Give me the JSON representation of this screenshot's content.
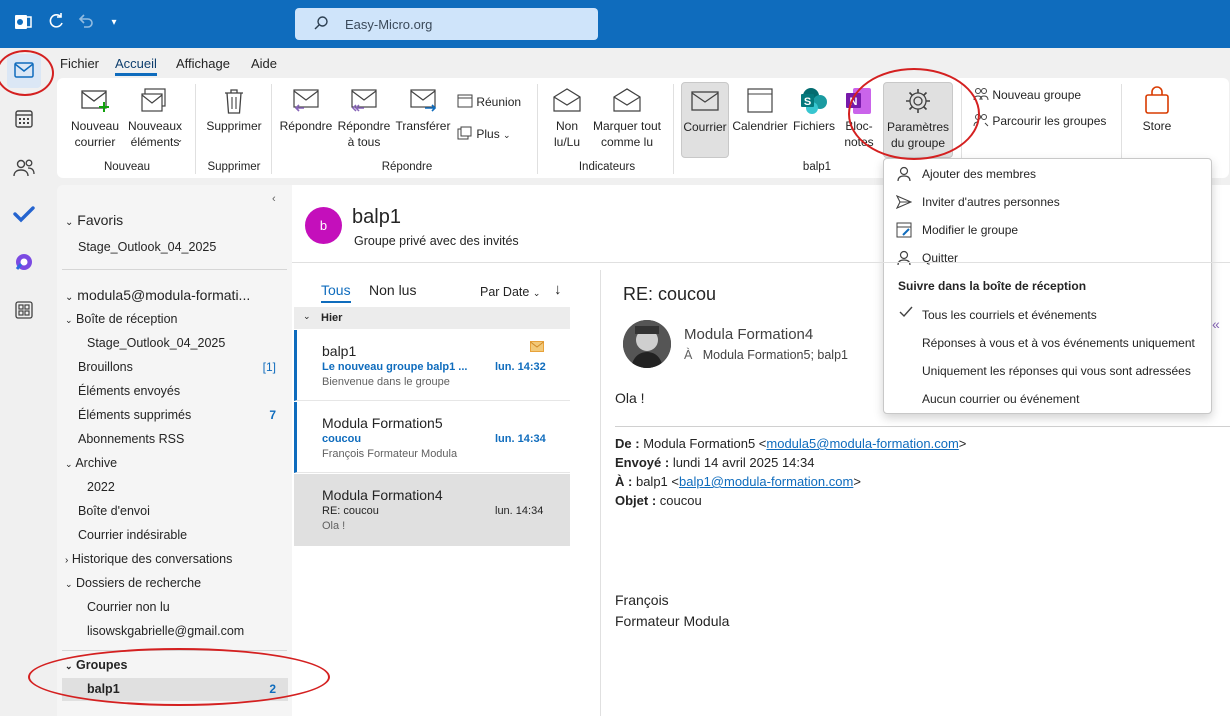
{
  "titlebar": {
    "search_text": "Easy-Micro.org"
  },
  "menu": {
    "tabs": [
      "Fichier",
      "Accueil",
      "Affichage",
      "Aide"
    ]
  },
  "ribbon": {
    "nouveau_courrier": "Nouveau\ncourrier",
    "nouveaux_elements": "Nouveaux\néléments",
    "group_nouveau": "Nouveau",
    "supprimer": "Supprimer",
    "group_supprimer": "Supprimer",
    "repondre": "Répondre",
    "repondre_tous": "Répondre\nà tous",
    "transferer": "Transférer",
    "reunion": "Réunion",
    "plus": "Plus",
    "group_repondre": "Répondre",
    "non_lu": "Non\nlu/Lu",
    "marquer_tout": "Marquer tout\ncomme lu",
    "group_indicateurs": "Indicateurs",
    "courrier": "Courrier",
    "calendrier": "Calendrier",
    "fichiers": "Fichiers",
    "bloc_notes": "Bloc-\nnotes",
    "parametres": "Paramètres\ndu groupe",
    "group_balp1": "balp1",
    "nouveau_groupe": "Nouveau groupe",
    "parcourir_groupes": "Parcourir les groupes",
    "store": "Store"
  },
  "folders": {
    "favoris": "Favoris",
    "fav1": "Stage_Outlook_04_2025",
    "account": "modula5@modula-formati...",
    "inbox": "Boîte de réception",
    "inbox_sub": "Stage_Outlook_04_2025",
    "brouillons": "Brouillons",
    "brouillons_count": "[1]",
    "envoyes": "Éléments envoyés",
    "supprimes": "Éléments supprimés",
    "supprimes_count": "7",
    "rss": "Abonnements RSS",
    "archive": "Archive",
    "archive_2022": "2022",
    "boite_envoi": "Boîte d'envoi",
    "indesirable": "Courrier indésirable",
    "historique": "Historique des conversations",
    "recherche": "Dossiers de recherche",
    "non_lu": "Courrier non lu",
    "gmail": "lisowskgabrielle@gmail.com",
    "groupes": "Groupes",
    "balp1": "balp1",
    "balp1_count": "2"
  },
  "group_header": {
    "avatar": "b",
    "name": "balp1",
    "subtitle": "Groupe privé avec des invités"
  },
  "list": {
    "tab_all": "Tous",
    "tab_unread": "Non lus",
    "sort": "Par Date",
    "section": "Hier",
    "items": [
      {
        "sender": "balp1",
        "subject": "Le nouveau groupe balp1 ...",
        "time": "lun. 14:32",
        "preview": "Bienvenue dans le groupe"
      },
      {
        "sender": "Modula Formation5",
        "subject": "coucou",
        "time": "lun. 14:34",
        "preview": "François  Formateur Modula"
      },
      {
        "sender": "Modula Formation4",
        "subject": "RE: coucou",
        "time": "lun. 14:34",
        "preview": "Ola !"
      }
    ]
  },
  "reading": {
    "subject": "RE: coucou",
    "from": "Modula Formation4",
    "to_label": "À",
    "to": "Modula Formation5; balp1",
    "greeting": "Ola !",
    "de_label": "De :",
    "de_value": "Modula Formation5 <",
    "de_email": "modula5@modula-formation.com",
    "de_end": ">",
    "envoye_label": "Envoyé :",
    "envoye_value": "lundi 14 avril 2025 14:34",
    "a_label": "À :",
    "a_value": "balp1 <",
    "a_email": "balp1@modula-formation.com",
    "a_end": ">",
    "objet_label": "Objet :",
    "objet_value": "coucou",
    "sig1": "François",
    "sig2": "Formateur Modula"
  },
  "dropdown": {
    "ajouter": "Ajouter des membres",
    "inviter": "Inviter d'autres personnes",
    "modifier": "Modifier le groupe",
    "quitter": "Quitter",
    "section": "Suivre dans la boîte de réception",
    "opt1": "Tous les courriels et événements",
    "opt2": "Réponses à vous et à vos événements uniquement",
    "opt3": "Uniquement les réponses qui vous sont adressées",
    "opt4": "Aucun courrier ou événement"
  },
  "colors": {
    "brand": "#0f6cbd",
    "annotation": "#d42020",
    "avatar": "#c40fbb"
  }
}
